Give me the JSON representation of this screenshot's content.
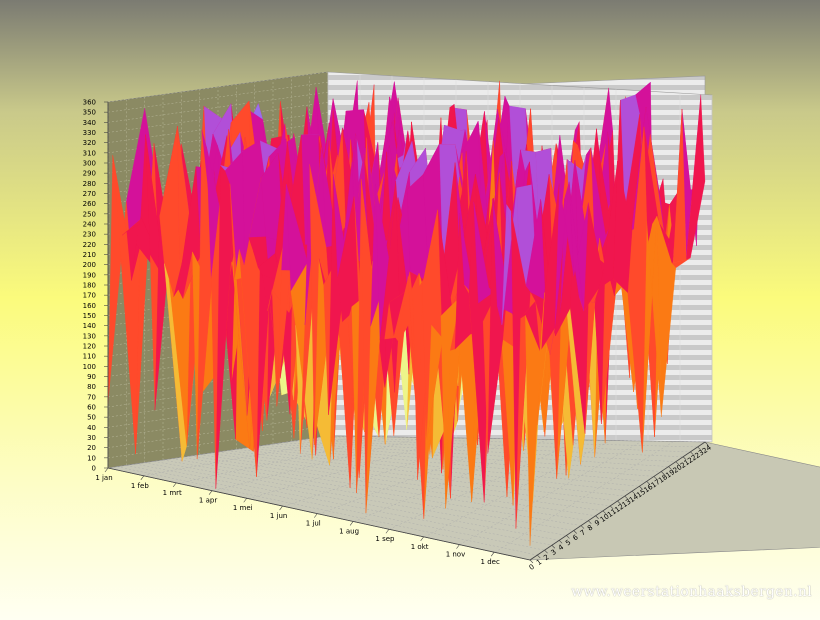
{
  "chart_data": {
    "type": "surface-3d",
    "title": "",
    "xlabel": "",
    "ylabel": "",
    "zlabel": "",
    "x_axis": {
      "categories": [
        "1 jan",
        "1 feb",
        "1 mrt",
        "1 apr",
        "1 mei",
        "1 jun",
        "1 jul",
        "1 aug",
        "1 sep",
        "1 okt",
        "1 nov",
        "1 dec"
      ],
      "days_in_year": 365,
      "month_start_days": [
        0,
        31,
        59,
        90,
        120,
        151,
        181,
        212,
        243,
        273,
        304,
        334
      ]
    },
    "y_axis": {
      "ticks": [
        0,
        1,
        2,
        3,
        4,
        5,
        6,
        7,
        8,
        9,
        10,
        11,
        12,
        13,
        14,
        15,
        16,
        17,
        18,
        19,
        20,
        21,
        22,
        23,
        24
      ],
      "range": [
        0,
        24
      ]
    },
    "z_axis": {
      "range": [
        0,
        360
      ],
      "ticks": [
        0,
        10,
        20,
        30,
        40,
        50,
        60,
        70,
        80,
        90,
        100,
        110,
        120,
        130,
        140,
        150,
        160,
        170,
        180,
        190,
        200,
        210,
        220,
        230,
        240,
        250,
        260,
        270,
        280,
        290,
        300,
        310,
        320,
        330,
        340,
        350,
        360
      ]
    },
    "grid": true,
    "colors": {
      "scale": [
        "#8f8ff2",
        "#a8dfe6",
        "#edf58a",
        "#f5bb35",
        "#fb7a14",
        "#ff4a2b",
        "#f0164e",
        "#d4119a",
        "#b14fd8",
        "#9770f0"
      ]
    },
    "series_summary": {
      "typical_value_range": [
        180,
        260
      ],
      "peak_value_range": [
        300,
        355
      ],
      "dip_value_range": [
        0,
        100
      ]
    }
  },
  "watermark": "www.weerstationhaaksbergen.nl"
}
